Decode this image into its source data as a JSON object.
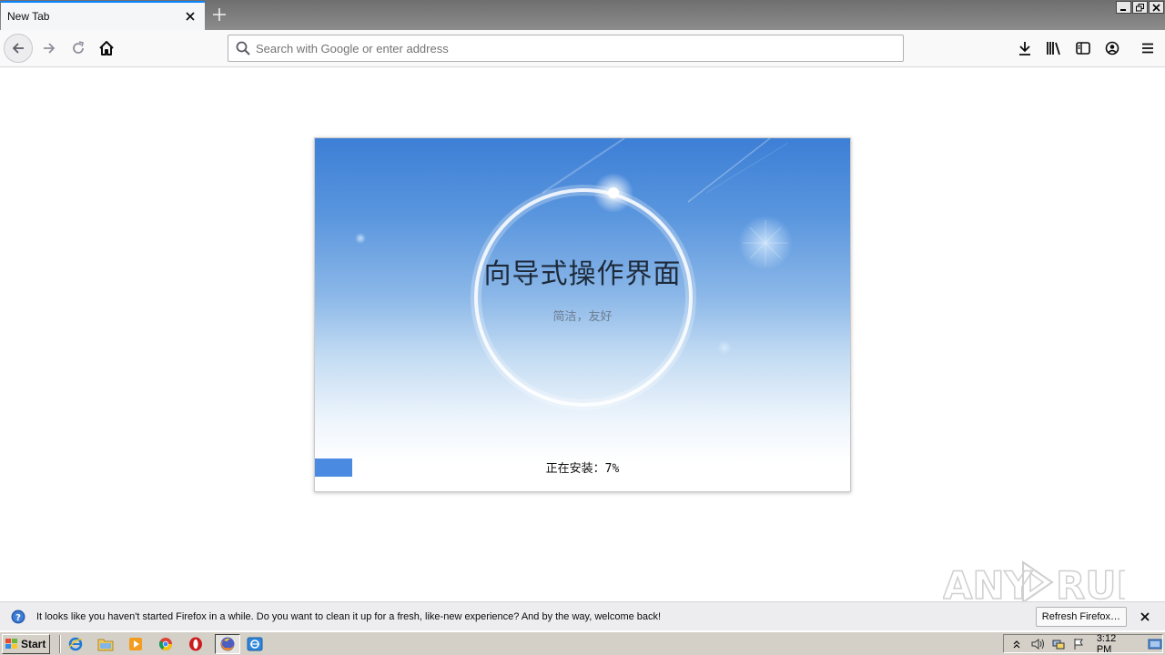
{
  "browser": {
    "tab_title": "New Tab",
    "search_placeholder": "Search with Google or enter address"
  },
  "installer": {
    "title": "向导式操作界面",
    "subtitle": "简洁，友好",
    "progress_label": "正在安装：7%",
    "progress_percent": 7,
    "progress_color": "#4a8ae0"
  },
  "watermark": {
    "text": "ANY RUN"
  },
  "notification": {
    "message": "It looks like you haven't started Firefox in a while. Do you want to clean it up for a fresh, like-new experience? And by the way, welcome back!",
    "button_label": "Refresh Firefox…"
  },
  "taskbar": {
    "start_label": "Start",
    "clock": "3:12 PM",
    "icons": [
      "internet-explorer-icon",
      "file-explorer-icon",
      "media-player-icon",
      "chrome-icon",
      "opera-icon",
      "firefox-icon",
      "app-icon"
    ]
  },
  "colors": {
    "accent": "#0a84ff",
    "installer_top": "#3d7fd6"
  }
}
